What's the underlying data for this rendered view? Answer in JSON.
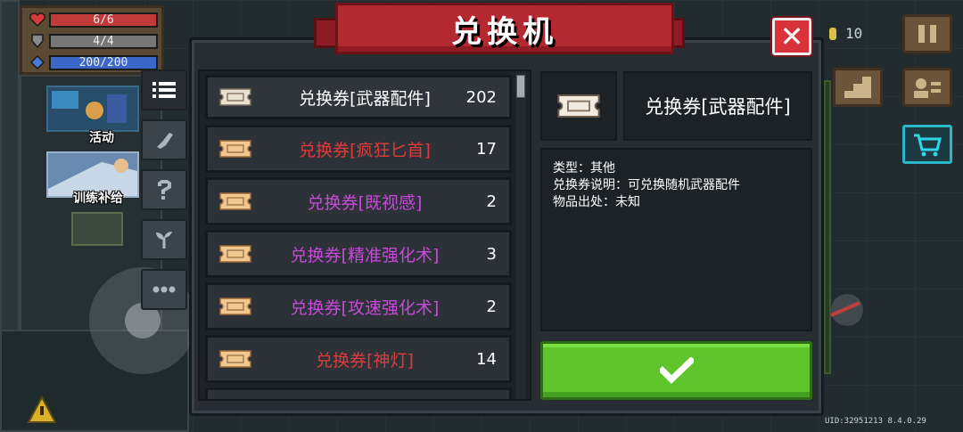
{
  "hud": {
    "hp": "6/6",
    "armor": "4/4",
    "energy": "200/200",
    "coins": "10",
    "uid": "UID:32951213 8.4.0.29"
  },
  "promos": [
    {
      "label": "活动"
    },
    {
      "label": "训练补给"
    }
  ],
  "modal": {
    "title": "兑换机",
    "side_tabs": [
      {
        "icon": "list-icon"
      },
      {
        "icon": "weapon-icon"
      },
      {
        "icon": "question-icon"
      },
      {
        "icon": "plant-icon"
      },
      {
        "icon": "more-icon"
      }
    ],
    "items": [
      {
        "name": "兑换券[武器配件]",
        "count": "202",
        "color": "#ffffff"
      },
      {
        "name": "兑换券[疯狂匕首]",
        "count": "17",
        "color": "#e23a3a"
      },
      {
        "name": "兑换券[既视感]",
        "count": "2",
        "color": "#c84ad8"
      },
      {
        "name": "兑换券[精准强化术]",
        "count": "3",
        "color": "#c84ad8"
      },
      {
        "name": "兑换券[攻速强化术]",
        "count": "2",
        "color": "#c84ad8"
      },
      {
        "name": "兑换券[神灯]",
        "count": "14",
        "color": "#e23a3a"
      }
    ],
    "detail": {
      "name": "兑换券[武器配件]",
      "type_line": "类型：其他",
      "desc_line": "兑换券说明：可兑换随机武器配件",
      "source_line": "物品出处：未知"
    }
  }
}
